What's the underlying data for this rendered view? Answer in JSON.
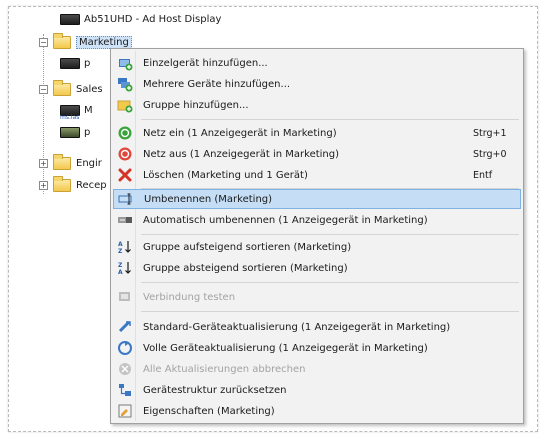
{
  "tree": {
    "top_item": "Ab51UHD - Ad Host Display",
    "marketing": "Marketing",
    "marketing_child_1": "p",
    "sales": "Sales",
    "sales_child_1": "M",
    "sales_child_1_sub": "ms.las",
    "sales_child_2": "p",
    "engineering": "Engir",
    "reception": "Recep",
    "expand_symbol": "+",
    "collapse_symbol": "−"
  },
  "menu": {
    "items": [
      {
        "label": "Einzelgerät hinzufügen...",
        "shortcut": "",
        "icon": "add-device-icon"
      },
      {
        "label": "Mehrere Geräte hinzufügen...",
        "shortcut": "",
        "icon": "add-devices-icon"
      },
      {
        "label": "Gruppe hinzufügen...",
        "shortcut": "",
        "icon": "add-group-icon"
      },
      {
        "label": "Netz ein  (1 Anzeigegerät in Marketing)",
        "shortcut": "Strg+1",
        "icon": "power-on-icon"
      },
      {
        "label": "Netz aus  (1 Anzeigegerät in Marketing)",
        "shortcut": "Strg+0",
        "icon": "power-off-icon"
      },
      {
        "label": "Löschen  (Marketing und 1 Gerät)",
        "shortcut": "Entf",
        "icon": "delete-icon"
      },
      {
        "label": "Umbenennen  (Marketing)",
        "shortcut": "",
        "icon": "rename-icon"
      },
      {
        "label": "Automatisch umbenennen  (1 Anzeigegerät in Marketing)",
        "shortcut": "",
        "icon": "auto-rename-icon"
      },
      {
        "label": "Gruppe aufsteigend sortieren  (Marketing)",
        "shortcut": "",
        "icon": "sort-ascending-icon"
      },
      {
        "label": "Gruppe absteigend sortieren  (Marketing)",
        "shortcut": "",
        "icon": "sort-descending-icon"
      },
      {
        "label": "Verbindung testen",
        "shortcut": "",
        "icon": "test-connection-icon"
      },
      {
        "label": "Standard-Geräteaktualisierung  (1 Anzeigegerät in Marketing)",
        "shortcut": "",
        "icon": "standard-update-icon"
      },
      {
        "label": "Volle Geräteaktualisierung  (1 Anzeigegerät in Marketing)",
        "shortcut": "",
        "icon": "full-update-icon"
      },
      {
        "label": "Alle Aktualisierungen abbrechen",
        "shortcut": "",
        "icon": "cancel-updates-icon"
      },
      {
        "label": "Gerätestruktur zurücksetzen",
        "shortcut": "",
        "icon": "reset-structure-icon"
      },
      {
        "label": "Eigenschaften  (Marketing)",
        "shortcut": "",
        "icon": "properties-icon"
      }
    ],
    "highlighted_index": 6,
    "disabled_indices": [
      10,
      13
    ]
  }
}
